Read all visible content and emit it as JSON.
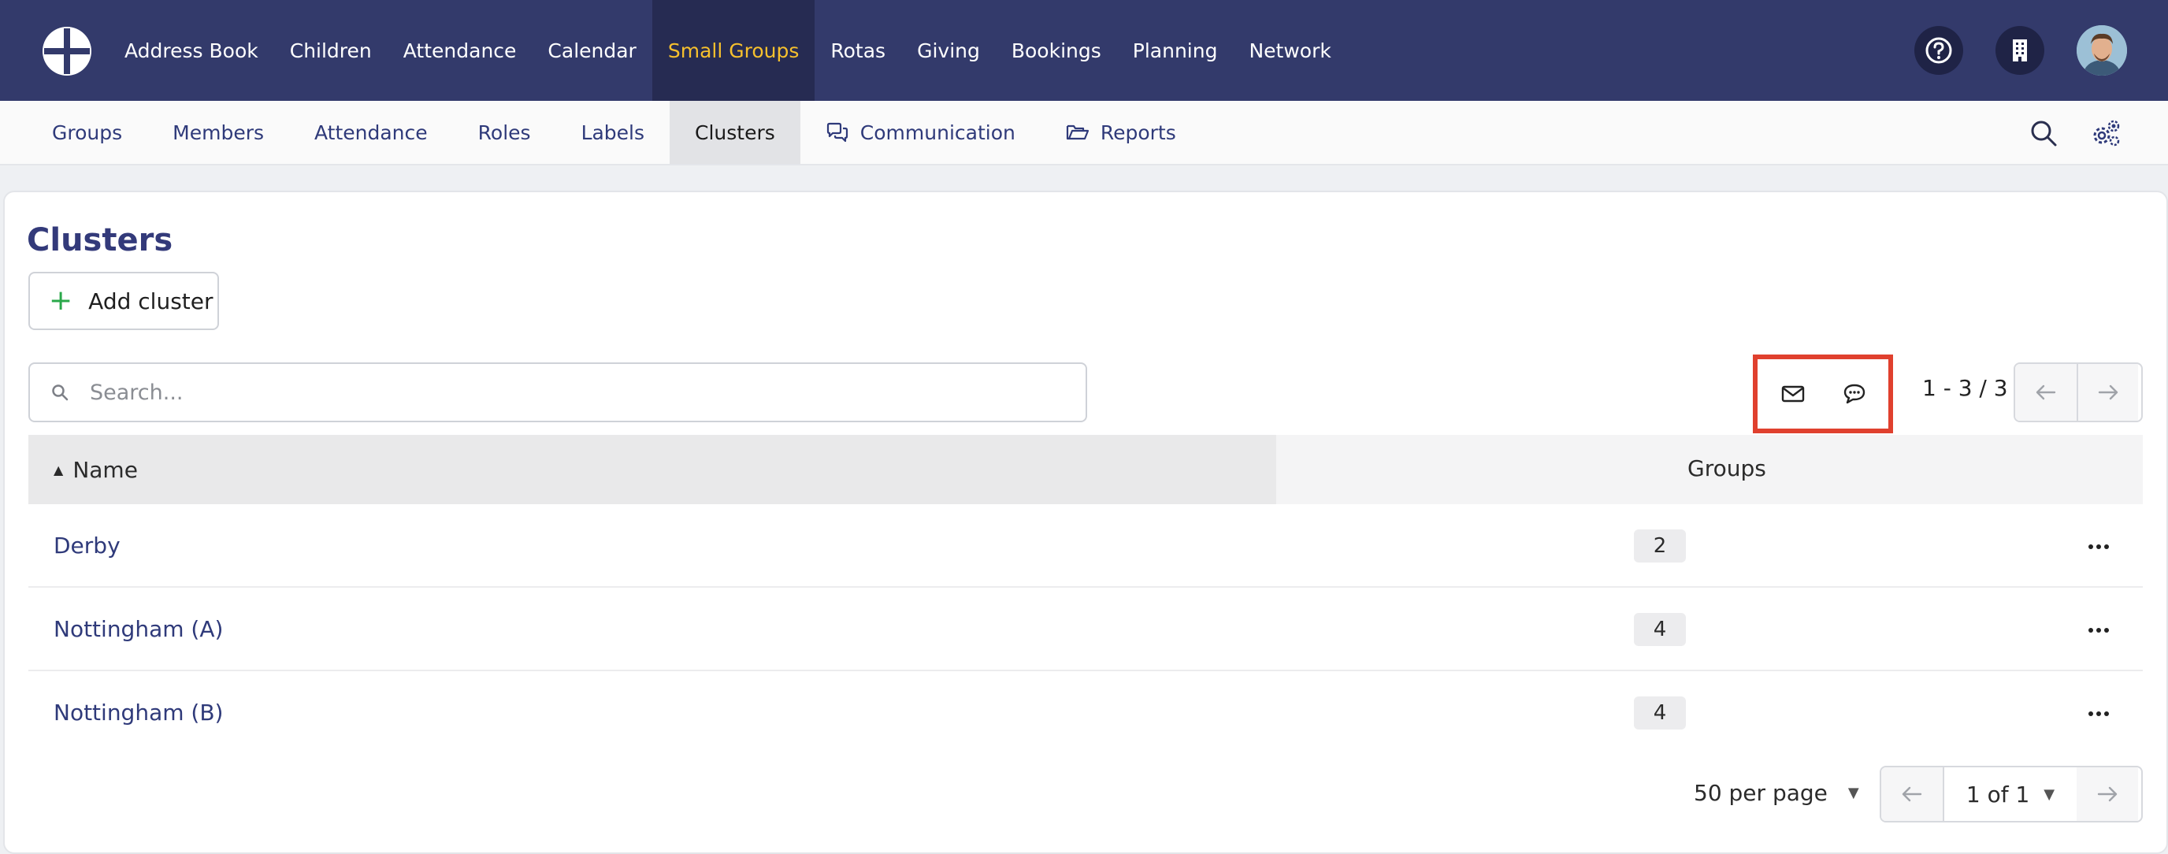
{
  "topnav": {
    "items": [
      {
        "label": "Address Book"
      },
      {
        "label": "Children"
      },
      {
        "label": "Attendance"
      },
      {
        "label": "Calendar"
      },
      {
        "label": "Small Groups",
        "active": true
      },
      {
        "label": "Rotas"
      },
      {
        "label": "Giving"
      },
      {
        "label": "Bookings"
      },
      {
        "label": "Planning"
      },
      {
        "label": "Network"
      }
    ],
    "icons": [
      "logo-icon",
      "help-icon",
      "building-icon",
      "avatar"
    ]
  },
  "subnav": {
    "tabs": [
      {
        "label": "Groups"
      },
      {
        "label": "Members"
      },
      {
        "label": "Attendance"
      },
      {
        "label": "Roles"
      },
      {
        "label": "Labels"
      },
      {
        "label": "Clusters",
        "active": true
      },
      {
        "label": "Communication",
        "icon": "chat-bubbles-icon"
      },
      {
        "label": "Reports",
        "icon": "folder-open-icon"
      }
    ],
    "icons": [
      "search-icon",
      "settings-gears-icon"
    ]
  },
  "page": {
    "title": "Clusters",
    "add_button": "Add cluster",
    "search_placeholder": "Search...",
    "range": "1 - 3 / 3"
  },
  "table": {
    "columns": {
      "name": "Name",
      "groups": "Groups"
    },
    "rows": [
      {
        "name": "Derby",
        "groups": "2"
      },
      {
        "name": "Nottingham (A)",
        "groups": "4"
      },
      {
        "name": "Nottingham (B)",
        "groups": "4"
      }
    ]
  },
  "footer": {
    "per_page": "50 per page",
    "page_select": "1 of 1"
  },
  "colors": {
    "topbar": "#333a6b",
    "active_nav_text": "#f6c02d",
    "link": "#2f3a7a",
    "highlight_box": "#e0402e",
    "add_plus": "#2aa84a"
  }
}
